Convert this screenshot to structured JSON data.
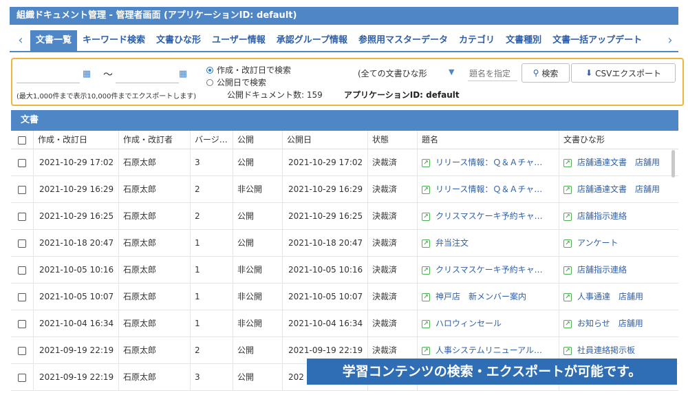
{
  "window": {
    "title": "組織ドキュメント管理 - 管理者画面 (アプリケーションID: default)"
  },
  "tabs": {
    "items": [
      {
        "label": "文書一覧",
        "active": true
      },
      {
        "label": "キーワード検索"
      },
      {
        "label": "文書ひな形"
      },
      {
        "label": "ユーザー情報"
      },
      {
        "label": "承認グループ情報"
      },
      {
        "label": "参照用マスターデータ"
      },
      {
        "label": "カテゴリ"
      },
      {
        "label": "文書種別"
      },
      {
        "label": "文書一括アップデート"
      }
    ],
    "prev_icon": "chevron-left-icon",
    "next_icon": "chevron-right-icon"
  },
  "search": {
    "tilde": "〜",
    "radio_created": "作成・改訂日で検索",
    "radio_published": "公開日で検索",
    "radio_selected": "created",
    "template_select": "(全ての文書ひな形",
    "title_placeholder": "題名を指定",
    "search_button": "検索",
    "csv_button": "CSVエクスポート",
    "note": "(最大1,000件まで表示10,000件までエクスポートします)",
    "public_count": "公開ドキュメント数: 159",
    "app_id": "アプリケーションID: default"
  },
  "section": {
    "title": "文書"
  },
  "columns": {
    "created": "作成・改訂日",
    "author": "作成・改訂者",
    "version": "バージ…",
    "public": "公開",
    "published": "公開日",
    "status": "状態",
    "title": "題名",
    "template": "文書ひな形"
  },
  "rows": [
    {
      "created": "2021-10-29 17:02",
      "author": "石原太郎",
      "version": "3",
      "public": "公開",
      "published": "2021-10-29 17:02",
      "status": "決裁済",
      "title": "リリース情報：Ｑ＆Ａチャ…",
      "template": "店舗通達文書",
      "template2": "店舗用"
    },
    {
      "created": "2021-10-29 16:29",
      "author": "石原太郎",
      "version": "2",
      "public": "非公開",
      "published": "2021-10-29 16:29",
      "status": "決裁済",
      "title": "リリース情報：Ｑ＆Ａチャ…",
      "template": "店舗通達文書",
      "template2": "店舗用"
    },
    {
      "created": "2021-10-29 16:25",
      "author": "石原太郎",
      "version": "2",
      "public": "公開",
      "published": "2021-10-29 16:25",
      "status": "決裁済",
      "title": "クリスマスケーキ予約キャ…",
      "template": "店舗指示連絡",
      "template2": ""
    },
    {
      "created": "2021-10-18 20:47",
      "author": "石原太郎",
      "version": "1",
      "public": "公開",
      "published": "2021-10-18 20:47",
      "status": "決裁済",
      "title": "弁当注文",
      "template": "アンケート",
      "template2": ""
    },
    {
      "created": "2021-10-05 10:16",
      "author": "石原太郎",
      "version": "1",
      "public": "非公開",
      "published": "2021-10-05 10:16",
      "status": "決裁済",
      "title": "クリスマスケーキ予約キャ…",
      "template": "店舗指示連絡",
      "template2": ""
    },
    {
      "created": "2021-10-05 10:07",
      "author": "石原太郎",
      "version": "1",
      "public": "非公開",
      "published": "2021-10-05 10:07",
      "status": "決裁済",
      "title": "神戸店　新メンバー案内",
      "template": "人事通達",
      "template2": "店舗用"
    },
    {
      "created": "2021-10-04 16:34",
      "author": "石原太郎",
      "version": "1",
      "public": "非公開",
      "published": "2021-10-04 16:34",
      "status": "決裁済",
      "title": "ハロウィンセール",
      "template": "お知らせ",
      "template2": "店舗用"
    },
    {
      "created": "2021-09-19 22:19",
      "author": "石原太郎",
      "version": "2",
      "public": "公開",
      "published": "2021-09-19 22:19",
      "status": "決裁済",
      "title": "人事システムリニューアル…",
      "template": "社員連絡掲示板",
      "template2": ""
    },
    {
      "created": "2021-09-19 22:19",
      "author": "石原太郎",
      "version": "3",
      "public": "公開",
      "published": "202",
      "status": "",
      "title": "",
      "template": "",
      "template2": ""
    }
  ],
  "banner": {
    "text": "学習コンテンツの検索・エクスポートが可能です。"
  },
  "colors": {
    "primary": "#4f87c6",
    "panel_border": "#f0b43c",
    "link": "#2d5fa8",
    "external_icon": "#4caf50",
    "banner": "#2f6db4"
  }
}
